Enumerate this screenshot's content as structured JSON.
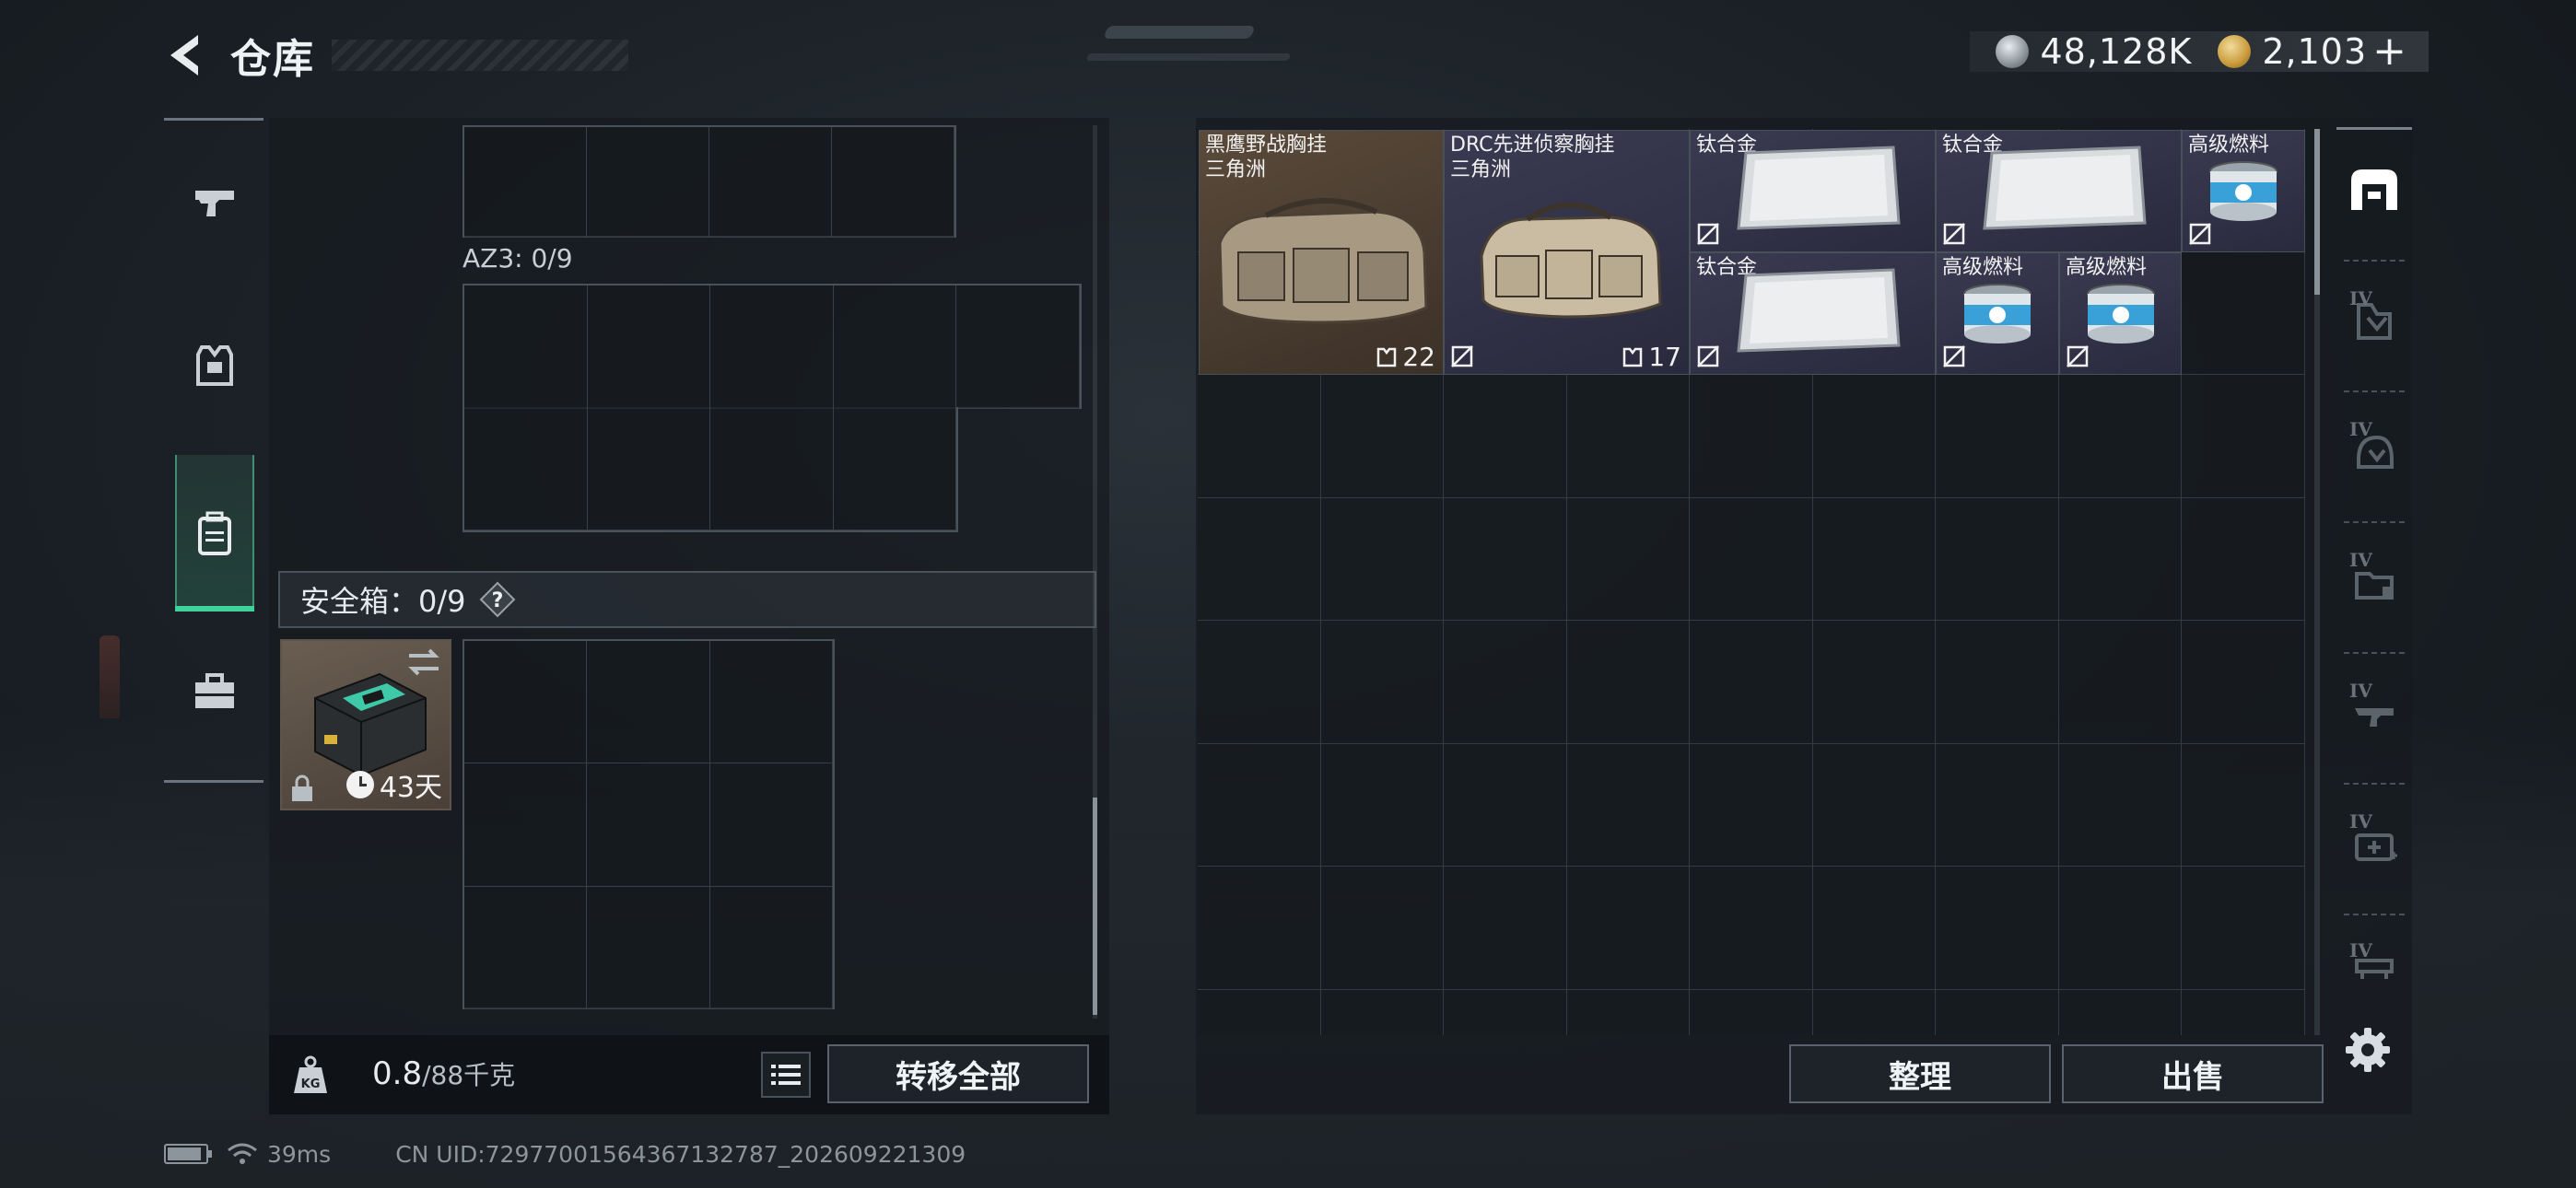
{
  "header": {
    "title": "仓库",
    "currency_silver": "48,128K",
    "currency_gold": "2,103"
  },
  "left": {
    "az3_label": "AZ3: 0/9",
    "safebox_label": "安全箱：0/9",
    "safebox_days": "43天",
    "weight_value": "0.8",
    "weight_unit": "/88千克",
    "transfer_all": "转移全部"
  },
  "right": {
    "items": [
      {
        "name1": "黑鹰野战胸挂",
        "name2": "三角洲",
        "count": "22",
        "rarity": "brown"
      },
      {
        "name1": "DRC先进侦察胸挂",
        "name2": "三角洲",
        "count": "17",
        "rarity": "purple"
      },
      {
        "name1": "钛合金",
        "rarity": "purple"
      },
      {
        "name1": "钛合金",
        "rarity": "purple"
      },
      {
        "name1": "高级燃料",
        "rarity": "purple"
      },
      {
        "name1": "钛合金",
        "rarity": "purple"
      },
      {
        "name1": "高级燃料",
        "rarity": "purple"
      },
      {
        "name1": "高级燃料",
        "rarity": "purple"
      }
    ],
    "sort_label": "整理",
    "sell_label": "出售",
    "tier_labels": [
      "IV",
      "IV",
      "IV",
      "IV",
      "IV",
      "IV"
    ]
  },
  "status": {
    "ping": "39ms",
    "uid": "CN UID:7297700156436713278​7_202609221309"
  },
  "colors": {
    "accent_green": "#3fd29a",
    "rarity_brown": "#5a4a3a",
    "rarity_purple": "#3a3a52"
  }
}
